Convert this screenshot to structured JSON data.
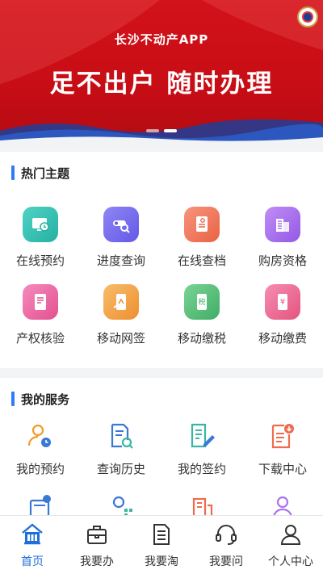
{
  "banner": {
    "app_name": "长沙不动产APP",
    "slogan": "足不出户 随时办理",
    "active_slide": 2,
    "slide_count": 2
  },
  "hot_topics": {
    "title": "热门主题",
    "items": [
      {
        "label": "在线预约",
        "icon": "monitor-calendar-icon",
        "color": "#33c2b4"
      },
      {
        "label": "进度查询",
        "icon": "progress-search-icon",
        "color": "#7a6ff0"
      },
      {
        "label": "在线查档",
        "icon": "document-search-icon",
        "color": "#f07b5e"
      },
      {
        "label": "购房资格",
        "icon": "building-icon",
        "color": "#a973ee"
      },
      {
        "label": "产权核验",
        "icon": "certificate-icon",
        "color": "#ee6aa7"
      },
      {
        "label": "移动网签",
        "icon": "mobile-sign-icon",
        "color": "#f3a24b"
      },
      {
        "label": "移动缴税",
        "icon": "mobile-tax-icon",
        "color": "#57c07a"
      },
      {
        "label": "移动缴费",
        "icon": "mobile-payment-icon",
        "color": "#f0689b"
      }
    ]
  },
  "my_services": {
    "title": "我的服务",
    "items": [
      {
        "label": "我的预约",
        "icon": "user-clock-icon"
      },
      {
        "label": "查询历史",
        "icon": "document-history-icon"
      },
      {
        "label": "我的签约",
        "icon": "contract-sign-icon"
      },
      {
        "label": "下载中心",
        "icon": "download-document-icon"
      },
      {
        "label": "",
        "icon": "message-book-icon"
      },
      {
        "label": "",
        "icon": "user-grid-icon"
      },
      {
        "label": "",
        "icon": "office-building-icon"
      },
      {
        "label": "",
        "icon": "user-profile-icon"
      }
    ]
  },
  "tabbar": {
    "items": [
      {
        "label": "首页",
        "icon": "home-icon",
        "active": true
      },
      {
        "label": "我要办",
        "icon": "briefcase-icon",
        "active": false
      },
      {
        "label": "我要淘",
        "icon": "document-list-icon",
        "active": false
      },
      {
        "label": "我要问",
        "icon": "headset-icon",
        "active": false
      },
      {
        "label": "个人中心",
        "icon": "person-icon",
        "active": false
      }
    ]
  },
  "colors": {
    "banner_red": "#c70d15",
    "accent_blue": "#2f7cf6",
    "tab_active": "#1f6fd9",
    "service_blue": "#3a78d6",
    "service_orange": "#f39a2b",
    "service_green": "#3bb6a4",
    "service_red": "#f06b4e"
  }
}
